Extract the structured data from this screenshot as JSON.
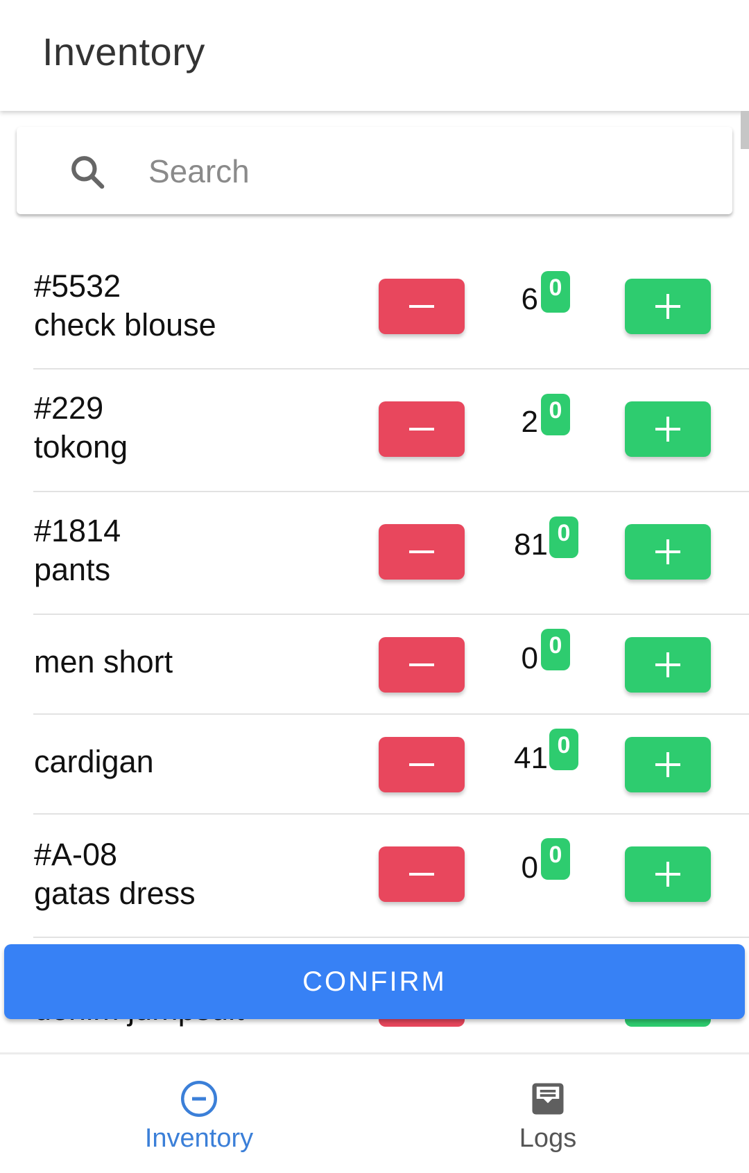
{
  "appbar": {
    "title": "Inventory"
  },
  "search": {
    "placeholder": "Search",
    "value": ""
  },
  "items": [
    {
      "code": "#5532",
      "name": "check blouse",
      "quantity": "6",
      "badge": "0"
    },
    {
      "code": "#229",
      "name": "tokong",
      "quantity": "2",
      "badge": "0"
    },
    {
      "code": "#1814",
      "name": "pants",
      "quantity": "81",
      "badge": "0"
    },
    {
      "code": "",
      "name": "men short",
      "quantity": "0",
      "badge": "0"
    },
    {
      "code": "",
      "name": "cardigan",
      "quantity": "41",
      "badge": "0"
    },
    {
      "code": "#A-08",
      "name": "gatas dress",
      "quantity": "0",
      "badge": "0"
    }
  ],
  "partial_item": {
    "name": "denim jumpsuit"
  },
  "confirm_label": "CONFIRM",
  "bottom_nav": [
    {
      "label": "Inventory",
      "icon": "minus-circle-icon",
      "active": true
    },
    {
      "label": "Logs",
      "icon": "inbox-tray-icon",
      "active": false
    }
  ],
  "colors": {
    "minus": "#e8475d",
    "plus": "#2ecc6f",
    "confirm": "#3781f5",
    "active_nav": "#3b7fd8"
  }
}
